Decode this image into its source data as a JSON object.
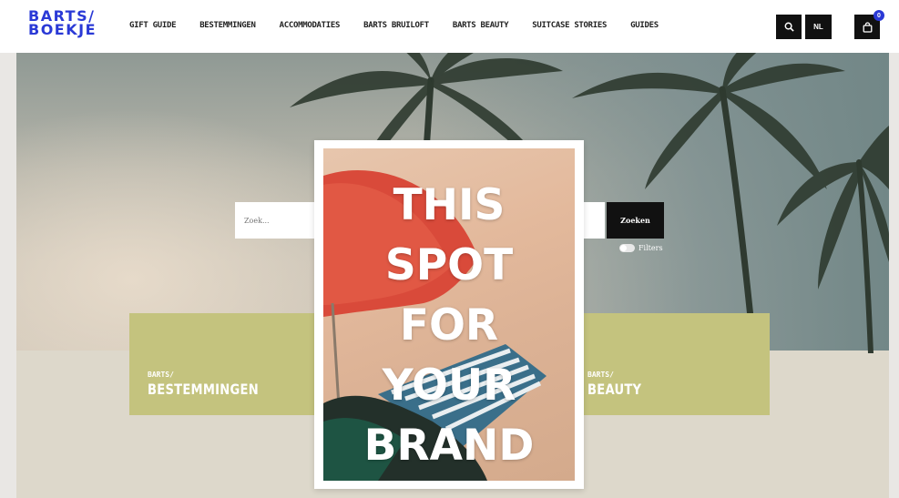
{
  "header": {
    "logo_line1": "BARTS/",
    "logo_line2": "BOEKJE",
    "nav": [
      "GIFT GUIDE",
      "BESTEMMINGEN",
      "ACCOMMODATIES",
      "BARTS BRUILOFT",
      "BARTS BEAUTY",
      "SUITCASE STORIES",
      "GUIDES"
    ],
    "language": "NL",
    "cart_count": "0",
    "icons": {
      "search": "search-icon",
      "cart": "shopping-bag-icon"
    }
  },
  "search": {
    "placeholder": "Zoek...",
    "submit_label": "Zoeken",
    "filters_label": "Filters"
  },
  "tiles": [
    {
      "small": "BARTS/",
      "big": "BESTEMMINGEN"
    },
    {
      "small": "BARTS/",
      "big": "BEAUTY"
    }
  ],
  "ad": {
    "lines": [
      "THIS",
      "SPOT",
      "FOR",
      "YOUR",
      "BRAND"
    ]
  },
  "colors": {
    "brand_blue": "#2a39d6",
    "tile_olive": "#c4c37e",
    "button_black": "#111111"
  }
}
